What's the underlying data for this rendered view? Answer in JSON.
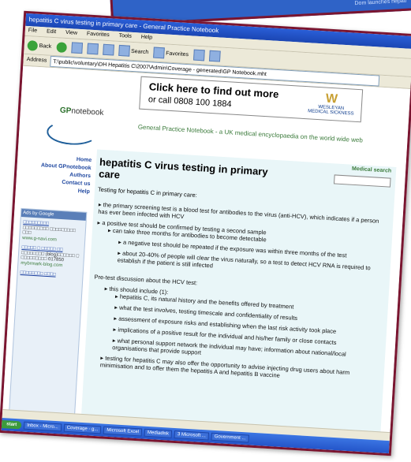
{
  "backcard": {
    "tag": "Dom launches hepati"
  },
  "window": {
    "title": "hepatitis C virus testing in primary care - General Practice Notebook",
    "menu": [
      "File",
      "Edit",
      "View",
      "Favorites",
      "Tools",
      "Help"
    ],
    "toolbar": {
      "back": "Back",
      "search": "Search",
      "favorites": "Favorites"
    },
    "address": {
      "label": "Address",
      "value": "T:\\public\\voluntary\\DH Hepatitis C\\2007\\Admin\\Coverage - generated\\GP Notebook.mht"
    }
  },
  "banner": {
    "line1": "Click here to find out more",
    "line2": "or call 0808 100 1884",
    "brand": "WESLEYAN",
    "brand_sub": "MEDICAL SICKNESS"
  },
  "site": {
    "logo_text_prefix": "GP",
    "logo_text": "notebook",
    "tagline": "General Practice Notebook - a UK medical encyclopaedia on the world wide web"
  },
  "nav": [
    "Home",
    "About GPnotebook",
    "Authors",
    "Contact us",
    "Help"
  ],
  "ads": {
    "header": "Ads by Google",
    "items": [
      {
        "link": "□□□□□□□□□",
        "text": "□□□□□□□□□ □□□□□□□□□ □□□",
        "url": "www.g-navi.com"
      },
      {
        "link": "□□□□□ □ □□□□□ □□",
        "text": "□□□□□□□□ (blog)□□□□□□ □ □□□□□□□□□ 017850",
        "url": "mybrmark-blog.com"
      },
      {
        "link": "□□□□□□□□ □□□□",
        "text": "",
        "url": ""
      }
    ]
  },
  "article": {
    "medical_search": "Medical search",
    "title": "hepatitis C virus testing in primary care",
    "intro": "Testing for hepatitis C in primary care:",
    "section1": [
      {
        "level": 0,
        "text": "the primary screening test is a blood test for antibodies to the virus (anti-HCV), which indicates if a person has ever been infected with HCV"
      },
      {
        "level": 0,
        "text": "a positive test should be confirmed by testing a second sample"
      },
      {
        "level": 1,
        "text": "can take three months for antibodies to become detectable"
      },
      {
        "level": 1,
        "text": "a negative test should be repeated if the exposure was within three months of the test"
      },
      {
        "level": 1,
        "text": "about 20-40% of people will clear the virus naturally, so a test to detect HCV RNA is required to establish if the patient is still infected"
      }
    ],
    "pretest": "Pre-test discussion about the HCV test:",
    "section2": [
      {
        "level": 0,
        "text": "this should include (1):"
      },
      {
        "level": 1,
        "text": "hepatitis C, its natural history and the benefits offered by treatment"
      },
      {
        "level": 1,
        "text": "what the test involves, testing timescale and confidentiality of results"
      },
      {
        "level": 1,
        "text": "assessment of exposure risks and establishing when the last risk activity took place"
      },
      {
        "level": 1,
        "text": "implications of a positive result for the individual and his/her family or close contacts"
      },
      {
        "level": 1,
        "text": "what personal support network the individual may have; information about national/local organisations that provide support"
      },
      {
        "level": 0,
        "text": "testing for hepatitis C may also offer the opportunity to advise injecting drug users about harm minimisation and to offer them the hepatitis A and hepatitis B vaccine"
      }
    ]
  },
  "taskbar": {
    "start": "start",
    "items": [
      "Inbox - Micro...",
      "Coverage - g...",
      "Microsoft Excel",
      "Mediadisk",
      "3 Microsoft ...",
      "Government ..."
    ]
  }
}
